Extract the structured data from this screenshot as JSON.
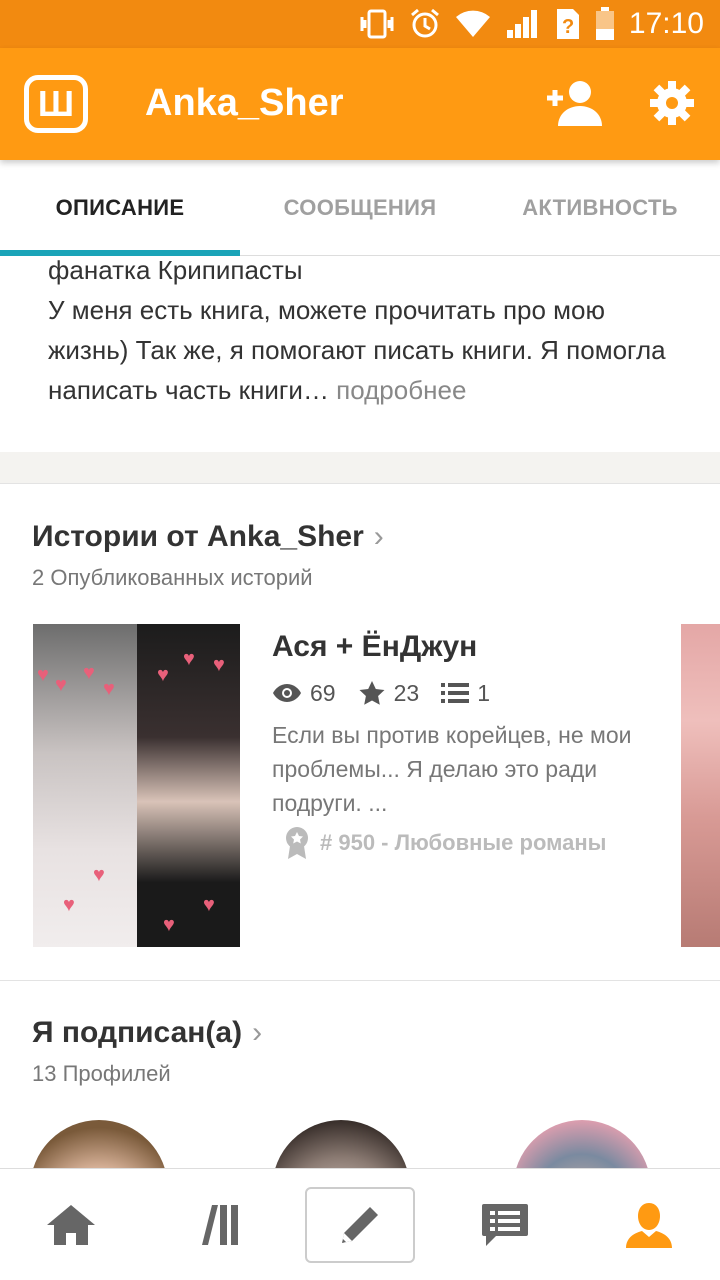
{
  "status_bar": {
    "time": "17:10",
    "icons": [
      "vibrate-icon",
      "alarm-icon",
      "wifi-icon",
      "signal-icon",
      "sim-unknown-icon",
      "battery-icon"
    ]
  },
  "app_bar": {
    "logo_letter": "Ш",
    "title": "Anka_Sher",
    "icons": [
      "add-user-icon",
      "gear-icon"
    ]
  },
  "tabs": [
    {
      "label": "ОПИСАНИЕ",
      "active": true
    },
    {
      "label": "СООБЩЕНИЯ",
      "active": false
    },
    {
      "label": "АКТИВНОСТЬ",
      "active": false
    }
  ],
  "description": {
    "text": "фанатка Крипипасты\nУ меня есть книга, можете прочитать про мою жизнь) Так же, я помогают писать книги. Я помогла написать часть книги",
    "ellipsis": "…",
    "more": "подробнее"
  },
  "stories_section": {
    "title": "Истории от Anka_Sher",
    "subtitle": "2 Опубликованных историй",
    "story": {
      "title": "Ася + ЁнДжун",
      "views": "69",
      "votes": "23",
      "parts": "1",
      "description": "Если вы против корейцев, не мои проблемы... Я делаю это ради подруги. ...",
      "rank": "# 950 - Любовные романы"
    }
  },
  "following_section": {
    "title": "Я подписан(а)",
    "subtitle": "13 Профилей"
  },
  "bottom_nav": [
    "home-icon",
    "library-icon",
    "write-icon",
    "messages-icon",
    "profile-icon"
  ],
  "colors": {
    "status_bar": "#f28a10",
    "app_bar": "#ff9a12",
    "tab_indicator": "#1aa4b8",
    "profile_active": "#ff9a12"
  }
}
